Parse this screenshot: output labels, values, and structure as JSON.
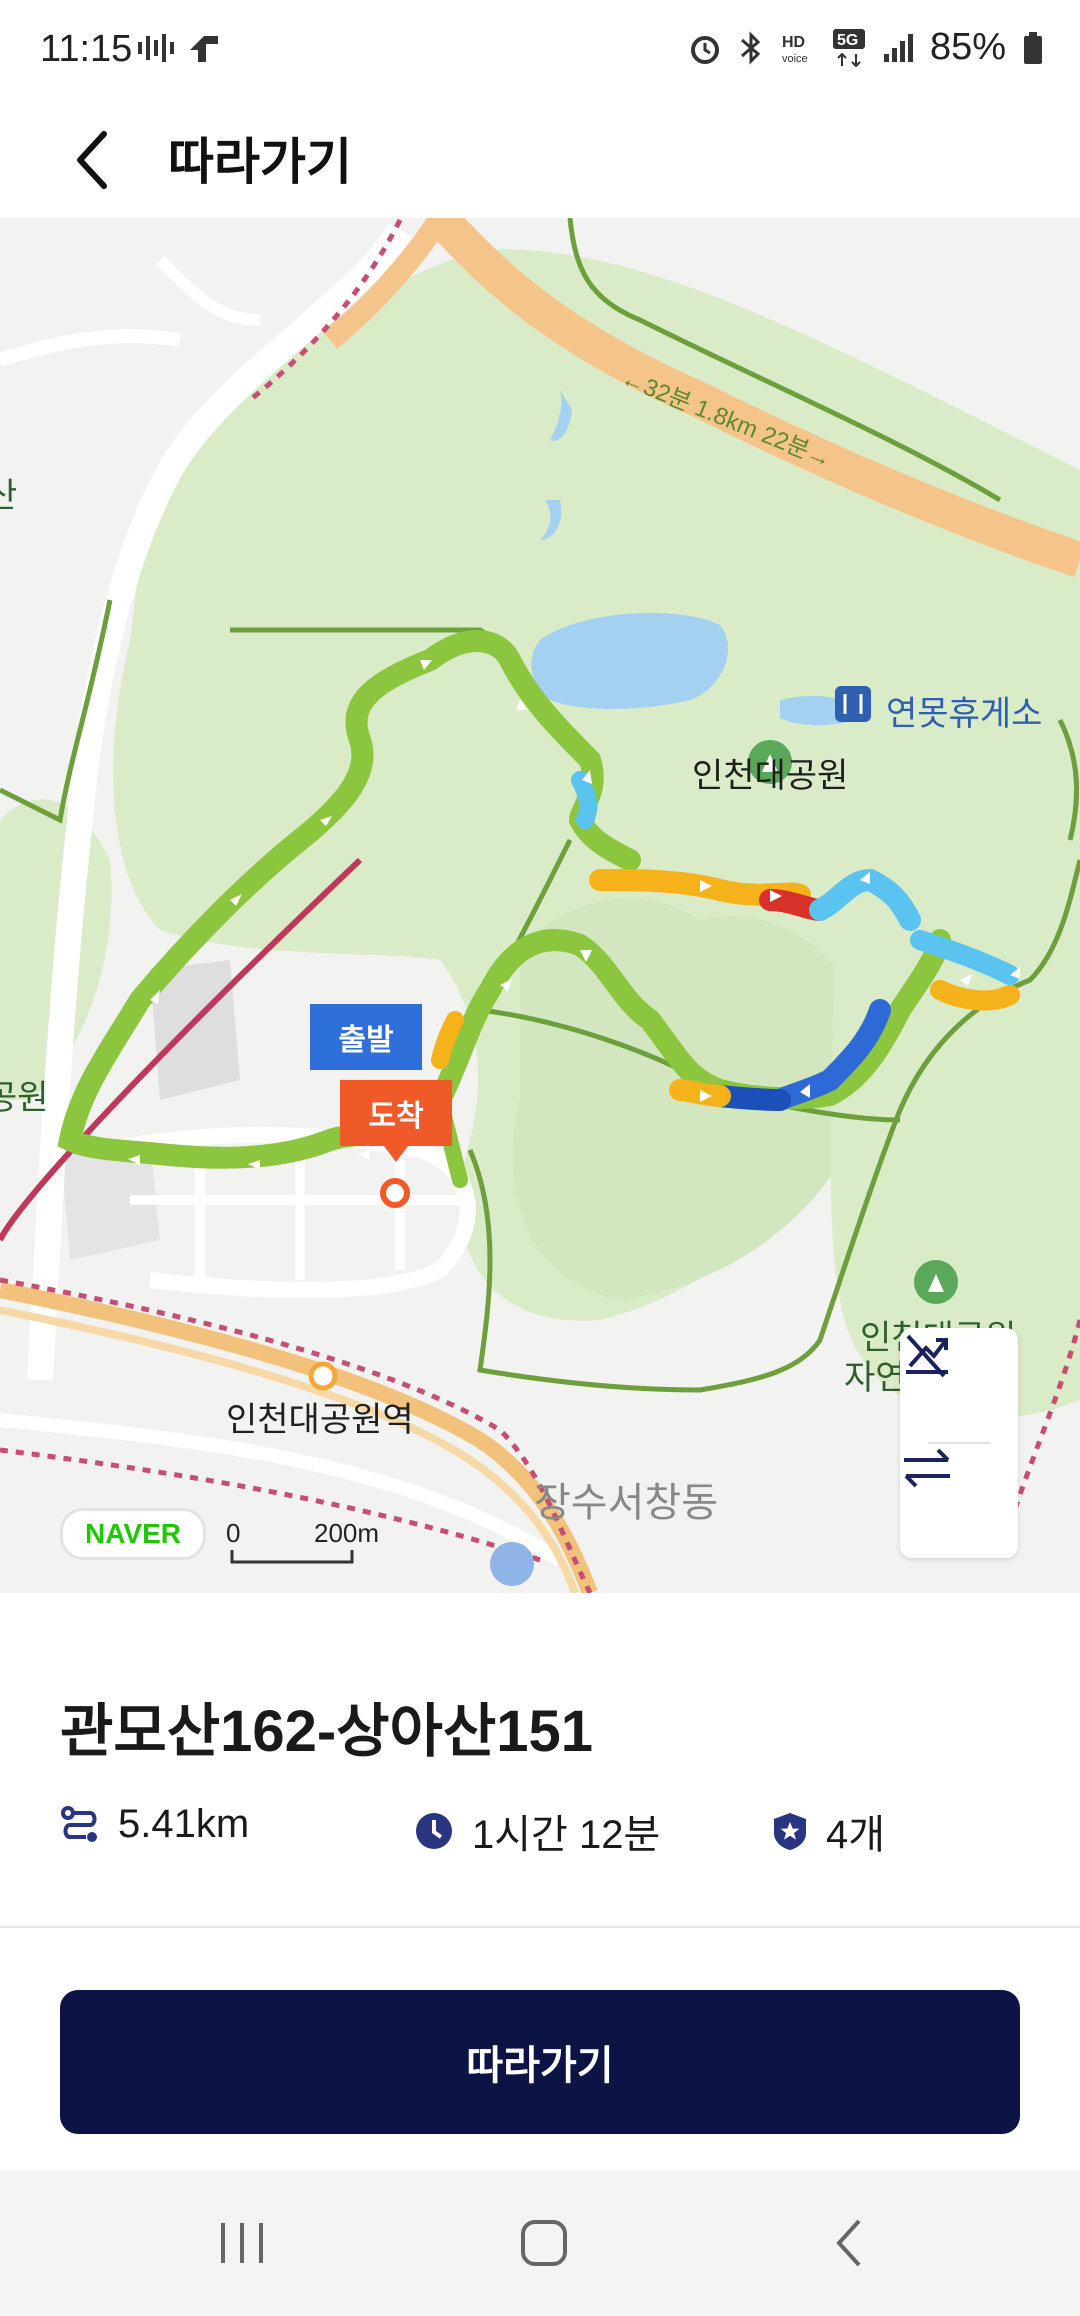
{
  "status_bar": {
    "time": "11:15",
    "battery": "85%",
    "icons": [
      "voice-activity-icon",
      "airplane-icon",
      "alarm-icon",
      "bluetooth-icon",
      "hd-voice-icon",
      "5g-icon",
      "signal-icon",
      "battery-icon"
    ]
  },
  "header": {
    "title": "따라가기",
    "back_icon": "chevron-left-icon"
  },
  "map": {
    "provider": "NAVER",
    "scale_zero": "0",
    "scale_distance": "200m",
    "markers": {
      "start": "출발",
      "end": "도착"
    },
    "labels": {
      "rest_area": "연못휴게소",
      "park": "인천대공원",
      "station": "인천대공원역",
      "district": "장수서창동",
      "forest_line1": "인천대공원",
      "forest_line2": "자연",
      "trail_annotation": "←32분 1.8km 22분→",
      "edge_left_1": "산",
      "edge_left_2": "공원"
    },
    "tools": [
      "elevation-toggle-icon",
      "swap-direction-icon"
    ]
  },
  "route": {
    "name": "관모산162-상아산151",
    "distance": "5.41km",
    "duration": "1시간 12분",
    "checkpoints": "4개"
  },
  "actions": {
    "follow_label": "따라가기"
  },
  "colors": {
    "primary": "#0b1445",
    "start_marker": "#2f6fd9",
    "end_marker": "#f05a28",
    "route_green": "#8cc63f",
    "naver_green": "#1ec800"
  },
  "nav_bar": [
    "recent-apps-icon",
    "home-icon",
    "back-icon"
  ]
}
